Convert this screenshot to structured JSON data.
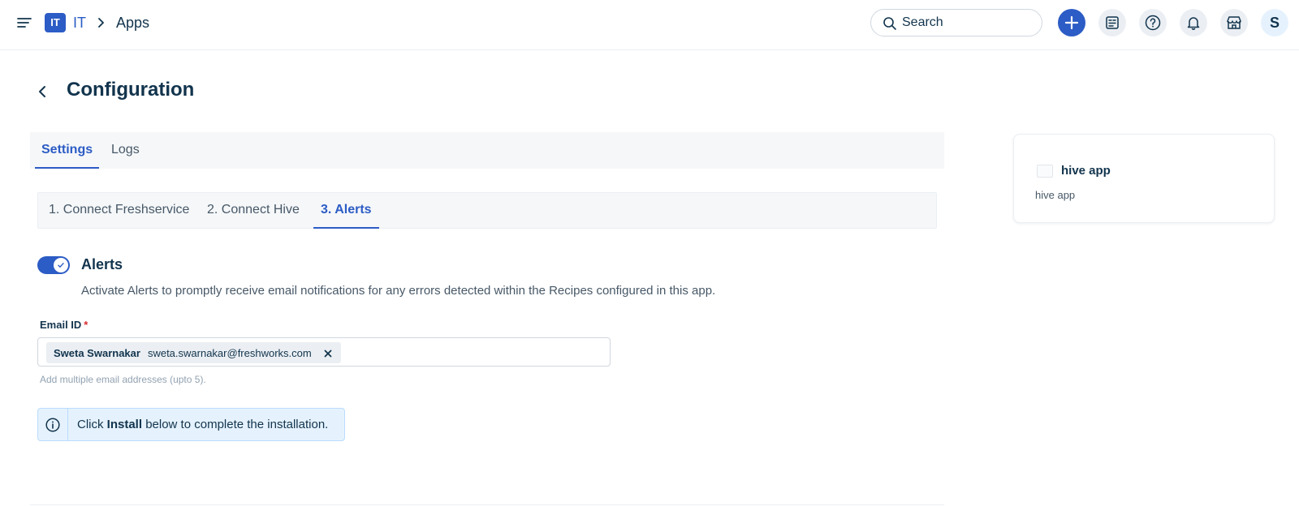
{
  "topbar": {
    "workspace_badge": "IT",
    "workspace_name": "IT",
    "breadcrumb_current": "Apps",
    "search_placeholder": "Search",
    "avatar_initial": "S",
    "icons": [
      "menu-icon",
      "chevron-right-icon",
      "search-icon",
      "plus-icon",
      "form-icon",
      "help-icon",
      "bell-icon",
      "store-icon"
    ]
  },
  "header": {
    "title": "Configuration"
  },
  "main_tabs": [
    {
      "label": "Settings",
      "active": true
    },
    {
      "label": "Logs",
      "active": false
    }
  ],
  "step_tabs": [
    {
      "label": "1. Connect Freshservice",
      "active": false
    },
    {
      "label": "2. Connect Hive",
      "active": false
    },
    {
      "label": "3. Alerts",
      "active": true
    }
  ],
  "alerts": {
    "enabled": true,
    "title": "Alerts",
    "description": "Activate Alerts to promptly receive email notifications for any errors detected within the Recipes configured in this app.",
    "email_label": "Email ID",
    "required_mark": "*",
    "chips": [
      {
        "name": "Sweta Swarnakar",
        "email": "sweta.swarnakar@freshworks.com"
      }
    ],
    "hint": "Add multiple email addresses (upto 5)."
  },
  "info_banner": {
    "prefix": "Click ",
    "strong": "Install",
    "suffix": " below to complete the installation."
  },
  "app_card": {
    "name": "hive app",
    "subtitle": "hive app"
  },
  "colors": {
    "primary": "#2c5cc5",
    "text": "#12344d",
    "muted": "#475867",
    "info_bg": "#e5f2fd",
    "required": "#d72d30"
  }
}
